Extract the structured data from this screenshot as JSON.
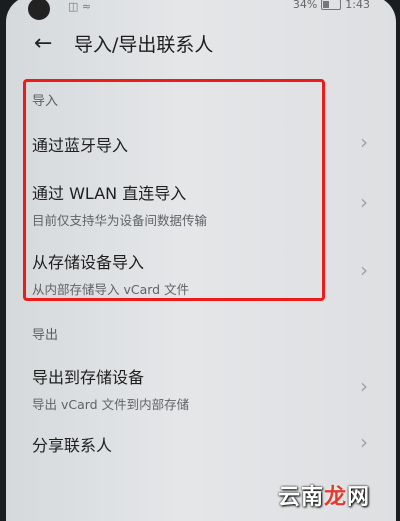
{
  "status_bar": {
    "left_icons": "◫ ≈",
    "battery": "34%",
    "time": "1:43"
  },
  "header": {
    "title": "导入/导出联系人"
  },
  "import_section": {
    "label": "导入",
    "items": [
      {
        "title": "通过蓝牙导入",
        "subtitle": ""
      },
      {
        "title": "通过 WLAN 直连导入",
        "subtitle": "目前仅支持华为设备间数据传输"
      },
      {
        "title": "从存储设备导入",
        "subtitle": "从内部存储导入 vCard 文件"
      }
    ]
  },
  "export_section": {
    "label": "导出",
    "items": [
      {
        "title": "导出到存储设备",
        "subtitle": "导出 vCard 文件到内部存储"
      },
      {
        "title": "分享联系人",
        "subtitle": ""
      }
    ]
  },
  "watermark": {
    "prefix": "云南",
    "accent": "龙",
    "suffix": "网"
  },
  "colors": {
    "highlight": "#ee1b1b"
  }
}
